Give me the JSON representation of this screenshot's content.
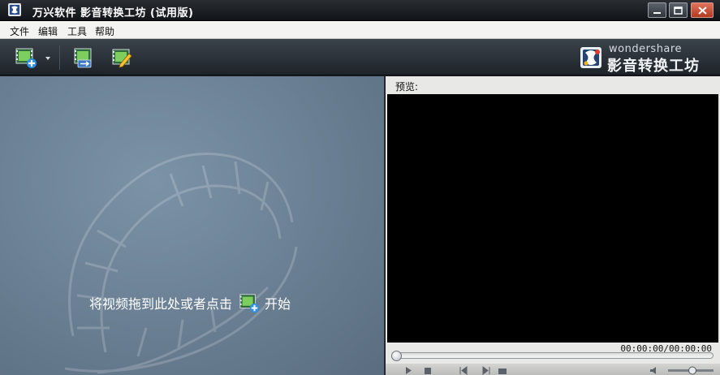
{
  "window": {
    "title": "万兴软件 影音转换工坊 (试用版)"
  },
  "menu": {
    "items": [
      {
        "label": "文件"
      },
      {
        "label": "编辑"
      },
      {
        "label": "工具"
      },
      {
        "label": "帮助"
      }
    ]
  },
  "toolbar": {
    "buttons": [
      {
        "icon": "add-video-icon"
      },
      {
        "icon": "dropdown-arrow-icon"
      },
      {
        "icon": "convert-video-icon"
      },
      {
        "icon": "edit-video-icon"
      }
    ]
  },
  "brand": {
    "company": "wondershare",
    "product": "影音转换工坊"
  },
  "drop_area": {
    "hint_prefix": "将视频拖到此处或者点击",
    "hint_suffix": "开始",
    "inline_icon": "add-video-icon"
  },
  "preview": {
    "label": "预览:",
    "time": "00:00:00/00:00:00"
  },
  "colors": {
    "titlebar": "#1f2328",
    "toolbar": "#2c333a",
    "drop_panel": "#6d8296",
    "preview_screen": "#000000",
    "close_button": "#c9472d"
  }
}
